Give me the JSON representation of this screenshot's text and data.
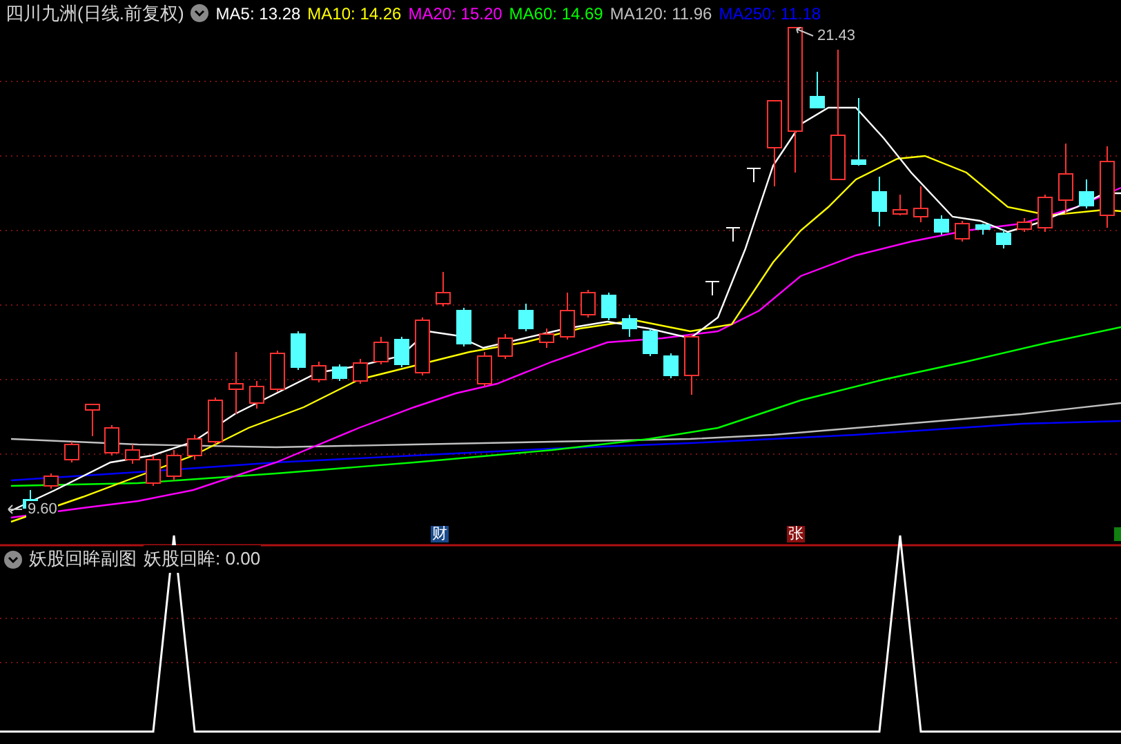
{
  "main_chart": {
    "title": "四川九洲(日线.前复权)",
    "ma_legend": [
      {
        "label": "MA5:",
        "value": "13.28",
        "color": "#ffffff"
      },
      {
        "label": "MA10:",
        "value": "14.26",
        "color": "#ffff00"
      },
      {
        "label": "MA20:",
        "value": "15.20",
        "color": "#ff00ff"
      },
      {
        "label": "MA60:",
        "value": "14.69",
        "color": "#00ff00"
      },
      {
        "label": "MA120:",
        "value": "11.96",
        "color": "#c0c0c0"
      },
      {
        "label": "MA250:",
        "value": "11.18",
        "color": "#0000ff"
      }
    ],
    "high_label": "21.43",
    "low_label": "9.60",
    "event_markers": [
      {
        "text": "财",
        "color": "#1a4a8a"
      },
      {
        "text": "张",
        "color": "#8a1010"
      }
    ]
  },
  "sub_chart": {
    "title": "妖股回眸副图",
    "reading_label": "妖股回眸:",
    "reading_value": "0.00"
  }
}
